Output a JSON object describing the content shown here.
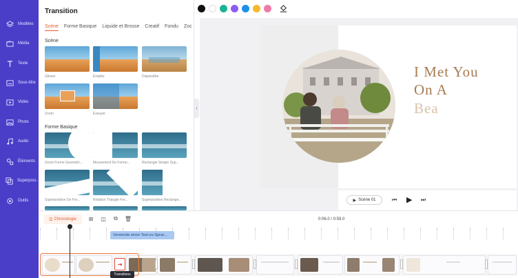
{
  "sidebar": {
    "items": [
      {
        "label": "Modèles",
        "icon": "layers-icon"
      },
      {
        "label": "Média",
        "icon": "folder-icon"
      },
      {
        "label": "Texte",
        "icon": "text-icon"
      },
      {
        "label": "Sous-titre",
        "icon": "subtitle-icon"
      },
      {
        "label": "Vidéo",
        "icon": "video-icon"
      },
      {
        "label": "Photo",
        "icon": "photo-icon"
      },
      {
        "label": "Audio",
        "icon": "music-icon"
      },
      {
        "label": "Éléments",
        "icon": "elements-icon"
      },
      {
        "label": "Superposi...",
        "icon": "overlay-icon"
      },
      {
        "label": "Outils",
        "icon": "tools-icon"
      }
    ]
  },
  "panel": {
    "title": "Transition",
    "tabs": [
      "Scène",
      "Forme Basique",
      "Liquide et Brosse",
      "Creatif",
      "Fondu",
      "Zoc"
    ],
    "active_tab": "Scène",
    "sections": [
      {
        "title": "Scène",
        "items": [
          "Glisser",
          "Empiler",
          "Disparaître",
          "Zoom",
          "Essuyer"
        ]
      },
      {
        "title": "Forme Basique",
        "items": [
          "Zoom Forme Geométri...",
          "Mouvement De Forme...",
          "Rectangle Simple Sup...",
          "Superposition De For...",
          "Rotation Triangle For...",
          "Superposition Rectange..."
        ]
      }
    ]
  },
  "toolbar": {
    "colors": [
      "#111111",
      "#ffffff",
      "#1ab394",
      "#8b5cf6",
      "#1e90e8",
      "#f5b82e",
      "#f07aa8"
    ],
    "tool_icon": "fill-bucket-icon"
  },
  "slide": {
    "lines": [
      "I Met You",
      "On A",
      "Bea"
    ]
  },
  "player": {
    "scene_label": "Scène 01"
  },
  "timeline": {
    "chrono_label": "Chronologie",
    "time_readout": "0:06.0 / 0:59.0",
    "tts_chip": "Verwende einen Text-zu-Sprac...",
    "tooltip": "Transitions"
  }
}
